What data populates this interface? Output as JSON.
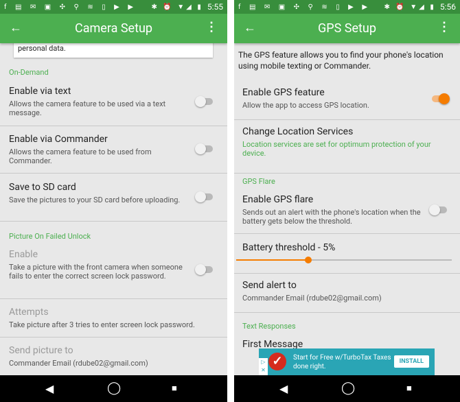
{
  "status_icons": "f ▤ ✉ ▣ ✣ ⚲ ≋ ▯ ▶ ▶",
  "status_sys": "✱ ⏰ ▼◢ ▮",
  "camera": {
    "time": "5:55",
    "title": "Camera Setup",
    "card_text": "personal data.",
    "sec1": "On-Demand",
    "items": [
      {
        "title": "Enable via text",
        "desc": "Allows the camera feature to be used via a text message.",
        "on": false
      },
      {
        "title": "Enable via Commander",
        "desc": "Allows the camera feature to be used from Commander.",
        "on": false
      },
      {
        "title": "Save to SD card",
        "desc": "Save the pictures to your SD card before uploading.",
        "on": false
      },
      {
        "title": "Enable",
        "desc": "Take a picture with the front camera when someone fails to enter the correct screen lock password.",
        "on": false
      },
      {
        "title": "Attempts",
        "desc": "Take picture after 3 tries to enter screen lock password."
      },
      {
        "title": "Send picture to",
        "desc": "Commander Email (rdube02@gmail.com)"
      }
    ],
    "sec2": "Picture On Failed Unlock"
  },
  "gps": {
    "time": "5:56",
    "title": "GPS Setup",
    "intro": "The GPS feature allows you to find your phone's location using mobile texting or Commander.",
    "enable": {
      "title": "Enable GPS feature",
      "desc": "Allow the app to access GPS location.",
      "on": true
    },
    "location": {
      "title": "Change Location Services",
      "desc": "Location services are set for optimum protection of your device."
    },
    "sec_flare": "GPS Flare",
    "flare": {
      "title": "Enable GPS flare",
      "desc": "Sends out an alert with the phone's location when the battery gets below the threshold.",
      "on": false
    },
    "battery": {
      "title": "Battery threshold - 5%",
      "value_percent": 5,
      "accent": "#f57c00"
    },
    "alert": {
      "title": "Send alert to",
      "desc": "Commander Email (rdube02@gmail.com)"
    },
    "sec_text": "Text Responses",
    "first_message": "First Message",
    "ad": {
      "text": "Start for Free w/TurboTax Taxes done right.",
      "button": "INSTALL"
    }
  },
  "nav": {
    "back": "◀",
    "home": "◯",
    "recent": "■"
  },
  "colors": {
    "primary": "#4caf50",
    "status": "#388e3c",
    "accent": "#f57c00"
  }
}
